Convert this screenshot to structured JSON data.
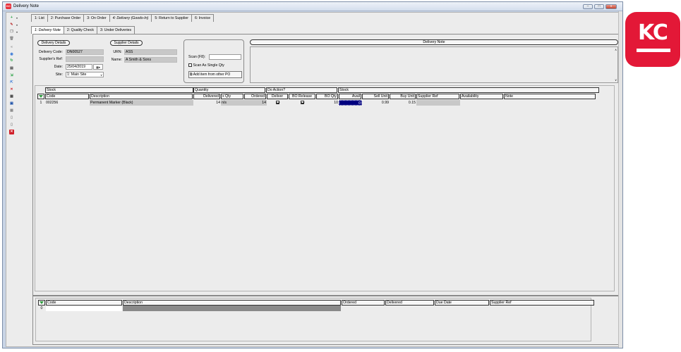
{
  "window": {
    "title": "Delivery Note",
    "app_icon": "KC",
    "min_label": "–",
    "max_label": "□",
    "close_label": "x"
  },
  "toolbar_icons": [
    {
      "name": "add-icon",
      "glyph": "+",
      "color": "#1e9e3a"
    },
    {
      "name": "edit-icon",
      "glyph": "✎",
      "color": "#b33"
    },
    {
      "name": "copy-icon",
      "glyph": "❐",
      "color": "#777"
    },
    {
      "name": "delete-icon",
      "glyph": "🗑",
      "color": "#888"
    },
    {
      "name": "back-icon",
      "glyph": "«",
      "color": "#888"
    },
    {
      "name": "globe-icon",
      "glyph": "◉",
      "color": "#3a7ad8"
    },
    {
      "name": "refresh-icon",
      "glyph": "↻",
      "color": "#1e9e3a"
    },
    {
      "name": "print-icon",
      "glyph": "▤",
      "color": "#444"
    },
    {
      "name": "import-icon",
      "glyph": "⇲",
      "color": "#1e9e3a"
    },
    {
      "name": "export-icon",
      "glyph": "⇱",
      "color": "#3a7ad8"
    },
    {
      "name": "cancel-icon",
      "glyph": "✕",
      "color": "#d0202a"
    },
    {
      "name": "report-icon",
      "glyph": "▦",
      "color": "#444"
    },
    {
      "name": "save-icon",
      "glyph": "▣",
      "color": "#1a4fa8"
    },
    {
      "name": "grid-icon",
      "glyph": "▦",
      "color": "#888"
    },
    {
      "name": "document-icon",
      "glyph": "▯",
      "color": "#888"
    },
    {
      "name": "page-icon",
      "glyph": "▯",
      "color": "#888"
    },
    {
      "name": "close-red-icon",
      "glyph": "✕",
      "color": "#fff",
      "bg": "#d0202a"
    }
  ],
  "main_tabs": [
    "1: List",
    "2: Purchase Order",
    "3: On Order",
    "4: Delivery (Goods-In)",
    "5: Return to Supplier",
    "6: Invoice"
  ],
  "sub_tabs": [
    "1: Delivery Note",
    "2: Quality Check",
    "3: Under Deliveries"
  ],
  "delivery": {
    "section_label": "Delivery Details",
    "code_label": "Delivery Code:",
    "code": "DN00527",
    "ref_label": "Supplier's Ref:",
    "ref": "",
    "date_label": "Date:",
    "date": "25/04/2019",
    "site_label": "Site:",
    "site": "1: Main Site"
  },
  "supplier": {
    "section_label": "Supplier Details",
    "urn_label": "URN:",
    "urn": "ASS",
    "name_label": "Name:",
    "name": "A Smith & Sons"
  },
  "scan": {
    "label": "Scan (F8):",
    "value": "",
    "single_qty_label": "Scan As Single Qty",
    "add_po_label": "Add item from other PO"
  },
  "note": {
    "title": "Delivery Note",
    "text": ""
  },
  "grid": {
    "groups": [
      "Stock",
      "Quantity",
      "Do Action?",
      "Stock"
    ],
    "headers": [
      "Code",
      "Description",
      "Delivered",
      "x Qty",
      "Ordered",
      "Deliver",
      "BO Release",
      "BO Qty",
      "Avail",
      "Sell Unit",
      "Buy Unit",
      "Supplier Ref",
      "Availability",
      "Note"
    ],
    "rows": [
      {
        "row": "1",
        "code": "002256",
        "description": "Permanent Marker (Black)",
        "delivered": "14",
        "xqty": "n/s",
        "ordered": "14",
        "deliver": true,
        "bo_release": true,
        "bo_qty": "10",
        "avail": "0",
        "sell_unit": "0.99",
        "buy_unit": "0.15",
        "supplier_ref": "",
        "availability": "",
        "note": ""
      }
    ]
  },
  "bottom_grid": {
    "headers": [
      "Code",
      "Description",
      "Ordered",
      "Delivered",
      "Due Date",
      "Supplier Ref"
    ],
    "rows": [
      {
        "row": "0"
      }
    ]
  },
  "brand": {
    "logo_text": "KC",
    "color": "#e31837"
  }
}
